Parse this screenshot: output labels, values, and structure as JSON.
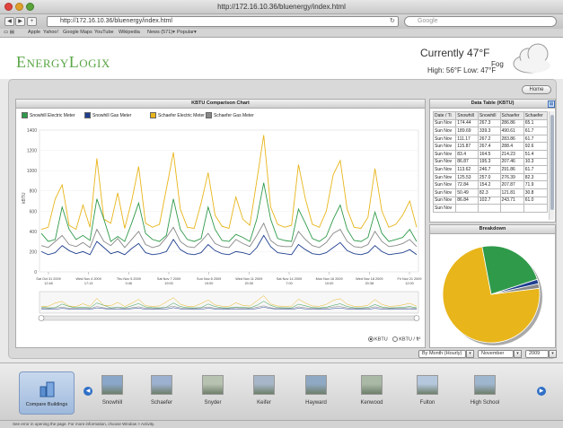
{
  "browser": {
    "title": "http://172.16.10.36/bluenergy/index.html",
    "url": "http://172.16.10.36/bluenergy/index.html",
    "search_placeholder": "Google",
    "bookmarks": [
      "Apple",
      "Yahoo!",
      "Google Maps",
      "YouTube",
      "Wikipedia",
      "News (571)▾",
      "Popular▾"
    ]
  },
  "header": {
    "logo": "EnergyLogix",
    "weather_now": "Currently 47°F",
    "weather_condition": "Fog",
    "weather_highlow": "High: 56°F  Low: 47°F",
    "weather_icon": "cloud-icon"
  },
  "home_button": "Home",
  "chart_panel": {
    "title": "KBTU Comparison Chart",
    "y_axis_label": "kBTU",
    "radio_kbtu": "KBTU",
    "radio_kbtu_sf": "KBTU / ft²"
  },
  "chart_data": {
    "type": "line",
    "title": "KBTU Comparison Chart",
    "ylabel": "kBTU",
    "ylim": [
      0,
      1400
    ],
    "yticks": [
      0,
      200,
      400,
      600,
      800,
      1000,
      1200,
      1400
    ],
    "x_tick_labels": [
      [
        "Sat Oct 31 2009",
        "12:46"
      ],
      [
        "Wed Nov 4 2009",
        "17:13"
      ],
      [
        "Thu Nov 5 2009",
        "0:46"
      ],
      [
        "Sat Nov 7 2009",
        "19:00"
      ],
      [
        "Sun Nov 8 2009",
        "19:00"
      ],
      [
        "Wed Nov 11 2009",
        "20:30"
      ],
      [
        "Sat Nov 14 2009",
        "7:00"
      ],
      [
        "Mon Nov 16 2009",
        "10:00"
      ],
      [
        "Wed Nov 18 2009",
        "20:38"
      ],
      [
        "Fri Nov 21 2009",
        "12:00"
      ]
    ],
    "series": [
      {
        "name": "Snowhill Electric Meter",
        "color": "#2f9a4a",
        "values": [
          380,
          300,
          320,
          640,
          420,
          320,
          360,
          310,
          720,
          520,
          300,
          350,
          300,
          480,
          680,
          380,
          320,
          300,
          360,
          720,
          420,
          320,
          300,
          330,
          640,
          420,
          310,
          300,
          370,
          340,
          300,
          520,
          880,
          520,
          330,
          310,
          300,
          620,
          480,
          330,
          300,
          350,
          520,
          660,
          420,
          310,
          300,
          340,
          590,
          380,
          300,
          320,
          340,
          420,
          300
        ]
      },
      {
        "name": "Snowhill Gas Meter",
        "color": "#1f3f8f",
        "values": [
          200,
          170,
          190,
          260,
          210,
          180,
          200,
          170,
          300,
          240,
          180,
          200,
          170,
          230,
          280,
          190,
          170,
          180,
          200,
          320,
          220,
          180,
          170,
          190,
          270,
          210,
          180,
          170,
          200,
          190,
          170,
          240,
          360,
          250,
          190,
          180,
          170,
          270,
          220,
          180,
          170,
          190,
          240,
          290,
          210,
          180,
          170,
          190,
          260,
          200,
          170,
          180,
          190,
          220,
          170
        ]
      },
      {
        "name": "Schaefer Electric Meter",
        "color": "#e8b51a",
        "values": [
          420,
          440,
          720,
          860,
          460,
          420,
          660,
          440,
          1120,
          520,
          480,
          780,
          430,
          700,
          1040,
          480,
          440,
          470,
          820,
          1180,
          620,
          440,
          430,
          680,
          980,
          560,
          450,
          430,
          740,
          520,
          460,
          900,
          1350,
          640,
          470,
          440,
          460,
          1060,
          720,
          470,
          440,
          600,
          960,
          1100,
          620,
          440,
          430,
          540,
          1020,
          600,
          440,
          470,
          560,
          700,
          440
        ]
      },
      {
        "name": "Schaefer Gas Meter",
        "color": "#888888",
        "values": [
          260,
          240,
          300,
          360,
          270,
          250,
          290,
          240,
          420,
          300,
          260,
          330,
          240,
          320,
          400,
          270,
          240,
          260,
          340,
          440,
          300,
          250,
          240,
          300,
          380,
          280,
          250,
          240,
          320,
          280,
          250,
          360,
          480,
          310,
          260,
          250,
          250,
          400,
          320,
          260,
          240,
          290,
          380,
          420,
          300,
          250,
          240,
          270,
          400,
          300,
          250,
          260,
          280,
          320,
          250
        ]
      }
    ]
  },
  "data_table": {
    "title": "Data Table (KBTU)",
    "headers": [
      "Date / Ti",
      "Snowhill",
      "Snowhill",
      "Schaefer",
      "Schaefer"
    ],
    "rows": [
      [
        "Sun Nov",
        "174.44",
        "267.3",
        "286.86",
        "65.1"
      ],
      [
        "Sun Nov",
        "189.69",
        "339.3",
        "490.61",
        "61.7"
      ],
      [
        "Sun Nov",
        "111.17",
        "267.2",
        "283.86",
        "61.7"
      ],
      [
        "Sun Nov",
        "115.87",
        "267.4",
        "288.4",
        "92.6"
      ],
      [
        "Sun Nov",
        "83.4",
        "164.5",
        "214.23",
        "51.4"
      ],
      [
        "Sun Nov",
        "86.87",
        "195.3",
        "207.46",
        "10.3"
      ],
      [
        "Sun Nov",
        "113.62",
        "246.7",
        "291.86",
        "61.7"
      ],
      [
        "Sun Nov",
        "125.53",
        "257.0",
        "276.39",
        "82.3"
      ],
      [
        "Sun Nov",
        "72.84",
        "154.2",
        "207.87",
        "71.9"
      ],
      [
        "Sun Nov",
        "50.49",
        "82.3",
        "121.81",
        "30.8"
      ],
      [
        "Sun Nov",
        "86.84",
        "102.7",
        "243.71",
        "61.0"
      ],
      [
        "Sun Nov",
        "",
        "",
        "",
        ""
      ]
    ]
  },
  "breakdown": {
    "title": "Breakdown",
    "slices": [
      {
        "name": "Schaefer Electric Meter",
        "value": 74,
        "color": "#e8b51a"
      },
      {
        "name": "Snowhill Electric Meter",
        "value": 23,
        "color": "#2f9a4a"
      },
      {
        "name": "Snowhill Gas Meter",
        "value": 1.5,
        "color": "#1f3f8f"
      },
      {
        "name": "Schaefer Gas Meter",
        "value": 1.5,
        "color": "#888888"
      }
    ]
  },
  "controls": {
    "interval": "By Month (Hourly)",
    "month": "November",
    "year": "2009"
  },
  "buildings_bar": {
    "compare_label": "Compare Buildings",
    "buildings": [
      "Snowhill",
      "Schaefer",
      "Snyder",
      "Keifer",
      "Hayward",
      "Kenwood",
      "Fulton",
      "High School"
    ]
  },
  "status_bar": "See error in opening the page. For more information, choose Window > Activity."
}
